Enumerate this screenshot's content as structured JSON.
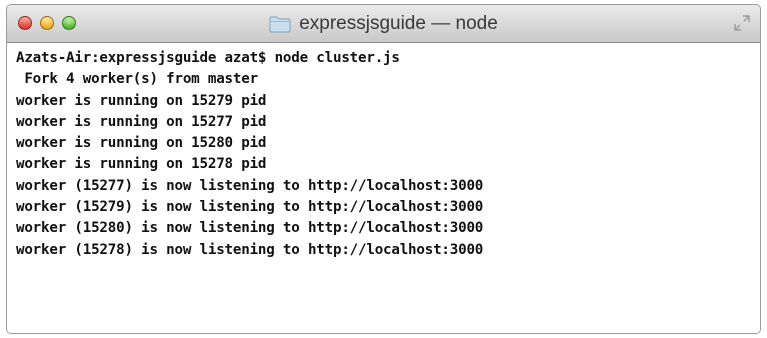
{
  "window": {
    "title": "expressjsguide — node",
    "traffic_lights": {
      "close_color": "#e2463a",
      "minimize_color": "#f2b32d",
      "zoom_color": "#5cc13a"
    },
    "icons": {
      "title": "folder-icon",
      "corner": "fullscreen-icon"
    }
  },
  "terminal": {
    "lines": [
      "Azats-Air:expressjsguide azat$ node cluster.js",
      " Fork 4 worker(s) from master",
      "worker is running on 15279 pid",
      "worker is running on 15277 pid",
      "worker is running on 15280 pid",
      "worker is running on 15278 pid",
      "worker (15277) is now listening to http://localhost:3000",
      "worker (15279) is now listening to http://localhost:3000",
      "worker (15280) is now listening to http://localhost:3000",
      "worker (15278) is now listening to http://localhost:3000"
    ]
  }
}
